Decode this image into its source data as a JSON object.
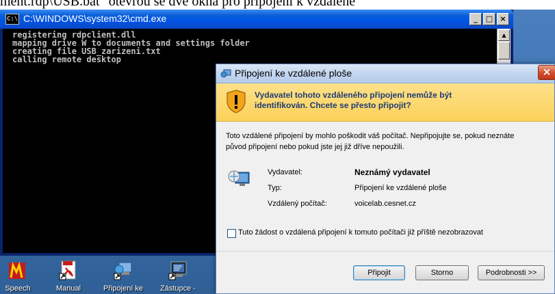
{
  "doc_strip_text": "ment.rdp\\USB.bat\" otevřou se dvě okna pro připojení k vzdálené",
  "cmd": {
    "icon_text": "C:\\",
    "title": "C:\\WINDOWS\\system32\\cmd.exe",
    "minimize": "_",
    "maximize": "□",
    "close": "×",
    "lines": [
      "registering rdpclient.dll",
      "mapping drive W to documents and settings folder",
      "creating file USB_zarizeni.txt",
      "calling remote desktop"
    ],
    "scroll_up": "▲"
  },
  "dialog": {
    "title": "Připojení ke vzdálené ploše",
    "close": "×",
    "warning_line1": "Vydavatel tohoto vzdáleného připojení nemůže být",
    "warning_line2": "identifikován. Chcete se přesto připojit?",
    "desc_line1": "Toto vzdálené připojení by mohlo poškodit váš počítač. Nepřipojujte se, pokud neznáte",
    "desc_line2": "původ připojení nebo pokud jste jej již dříve nepoužili.",
    "publisher_label": "Vydavatel:",
    "publisher_value": "Neznámý vydavatel",
    "type_label": "Typ:",
    "type_value": "Připojení ke vzdálené ploše",
    "computer_label": "Vzdálený počítač:",
    "computer_value": "voicelab.cesnet.cz",
    "checkbox_label": "Tuto žádost o vzdálená připojení k tomuto počítači již příště nezobrazovat",
    "checkbox_checked": false,
    "buttons": {
      "connect": "Připojit",
      "cancel": "Storno",
      "details": "Podrobnosti >>"
    }
  },
  "desktop_icons": [
    {
      "label": "Speech",
      "icon": "speech-app-icon"
    },
    {
      "label": "Manual",
      "icon": "pdf-shortcut-icon"
    },
    {
      "label": "Připojení ke",
      "icon": "remote-desktop-shortcut-icon"
    },
    {
      "label": "Zástupce -",
      "icon": "shortcut-icon"
    }
  ],
  "colors": {
    "console_bg": "#000000",
    "console_text": "#c0c0c0",
    "xp_title_blue": "#0054e3",
    "warning_band": "#fcd15a",
    "warning_text": "#1d3b73"
  }
}
